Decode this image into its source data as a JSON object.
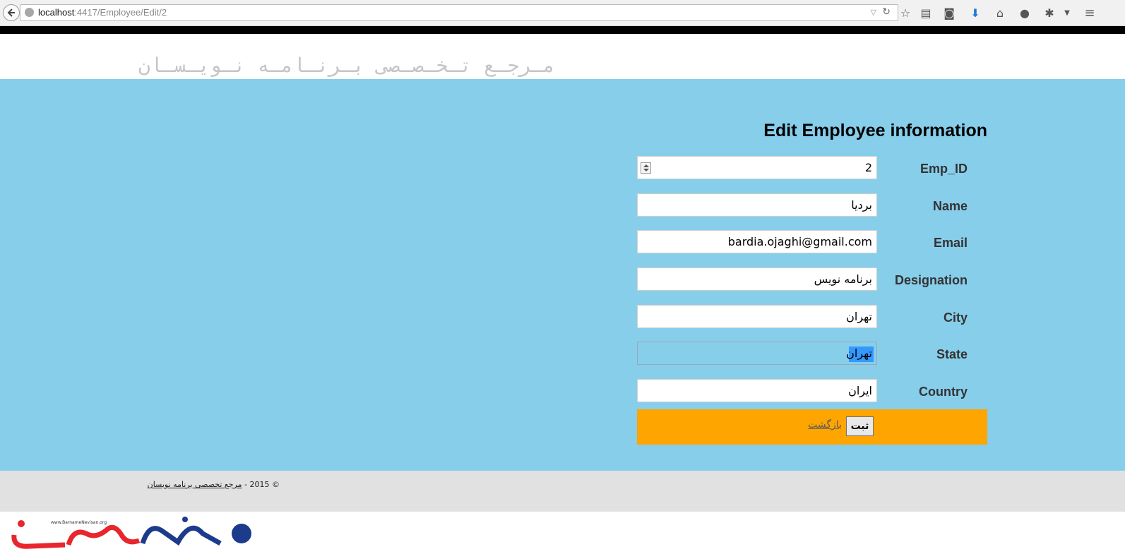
{
  "browser": {
    "url_host": "localhost",
    "url_path": ":4417/Employee/Edit/2"
  },
  "site": {
    "title": "مـرجـع تـخـصـصی بـرنـامـه نـویـسـان"
  },
  "form": {
    "title": "Edit Employee information",
    "fields": {
      "emp_id": {
        "label": "Emp_ID",
        "value": "2"
      },
      "name": {
        "label": "Name",
        "value": "بردیا"
      },
      "email": {
        "label": "Email",
        "value": "bardia.ojaghi@gmail.com"
      },
      "designation": {
        "label": "Designation",
        "value": "برنامه نویس"
      },
      "city": {
        "label": "City",
        "value": "تهران"
      },
      "state": {
        "label": "State",
        "value": "تهران"
      },
      "country": {
        "label": "Country",
        "value": "ایران"
      }
    },
    "submit_label": "ثبت",
    "back_label": "بازگشت"
  },
  "footer": {
    "copyright": "© 2015 -",
    "link_text": "مرجع تخصصی برنامه نویسان"
  },
  "logo": {
    "text": "برنامه نویسان",
    "url_text": "www.BarnameNevisan.org"
  },
  "colors": {
    "main_bg": "#87ceeb",
    "action_bar": "#ffa500",
    "footer_bg": "#e1e1e1",
    "logo_red": "#e8262d",
    "logo_blue": "#1d3b8c"
  }
}
